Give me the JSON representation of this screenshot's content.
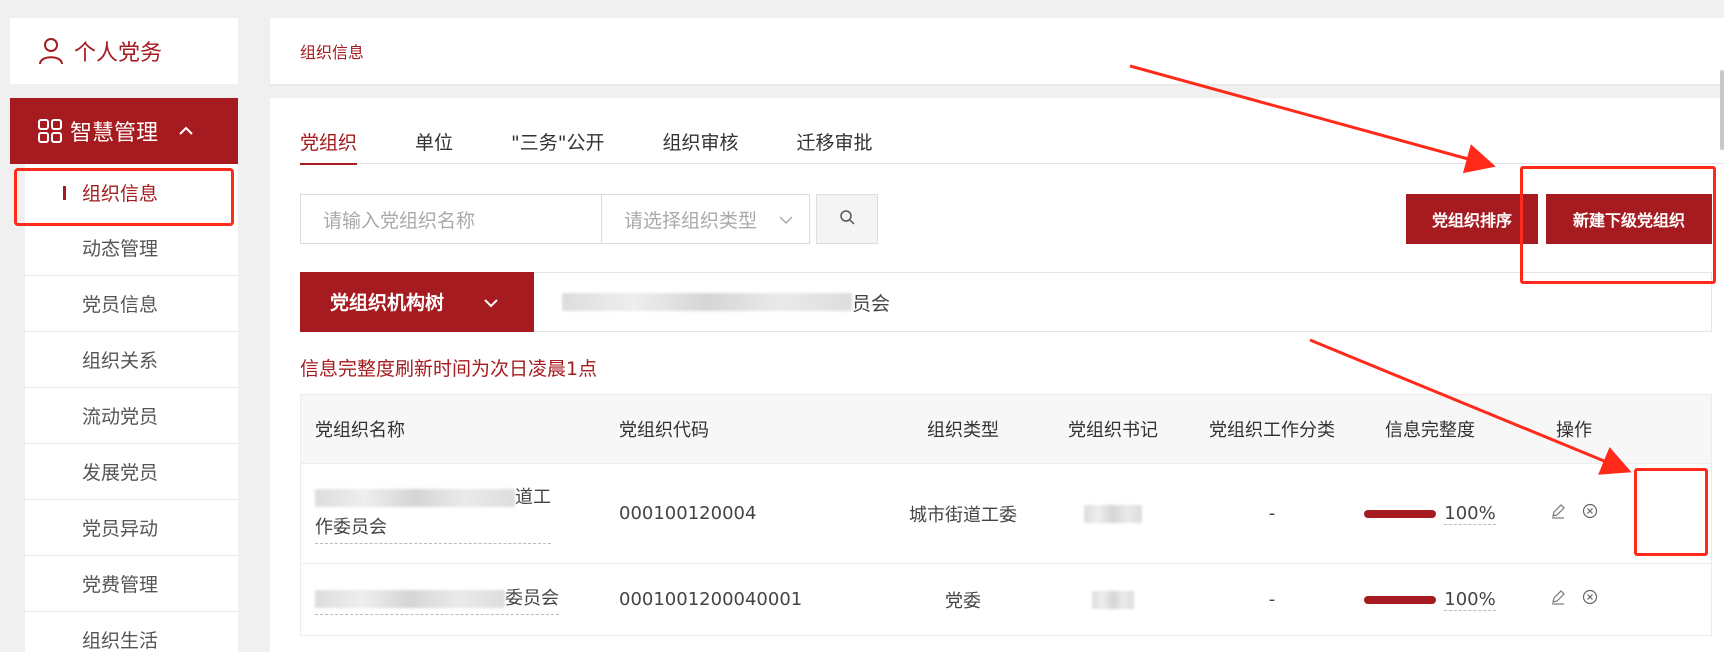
{
  "sidebar": {
    "personal_label": "个人党务",
    "smart_label": "智慧管理",
    "items": [
      {
        "label": "组织信息",
        "active": true
      },
      {
        "label": "动态管理"
      },
      {
        "label": "党员信息"
      },
      {
        "label": "组织关系"
      },
      {
        "label": "流动党员"
      },
      {
        "label": "发展党员"
      },
      {
        "label": "党员异动"
      },
      {
        "label": "党费管理"
      },
      {
        "label": "组织生活"
      }
    ]
  },
  "breadcrumb": "组织信息",
  "tabs": [
    "党组织",
    "单位",
    "\"三务\"公开",
    "组织审核",
    "迁移审批"
  ],
  "search": {
    "name_placeholder": "请输入党组织名称",
    "type_placeholder": "请选择组织类型"
  },
  "buttons": {
    "sort": "党组织排序",
    "new_sub": "新建下级党组织"
  },
  "tree": {
    "button_label": "党组织机构树",
    "org_suffix": "员会"
  },
  "notice": "信息完整度刷新时间为次日凌晨1点",
  "table": {
    "headers": [
      "党组织名称",
      "党组织代码",
      "组织类型",
      "党组织书记",
      "党组织工作分类",
      "信息完整度",
      "操作"
    ],
    "rows": [
      {
        "name_suffix_line1": "道工",
        "name_line2": "作委员会",
        "code": "000100120004",
        "type": "城市街道工委",
        "category": "-",
        "completeness": "100%"
      },
      {
        "name_suffix": "委员会",
        "code": "0001001200040001",
        "type": "党委",
        "category": "-",
        "completeness": "100%"
      }
    ]
  },
  "colors": {
    "brand": "#a51b1f",
    "annotation": "#ff2a1a"
  }
}
